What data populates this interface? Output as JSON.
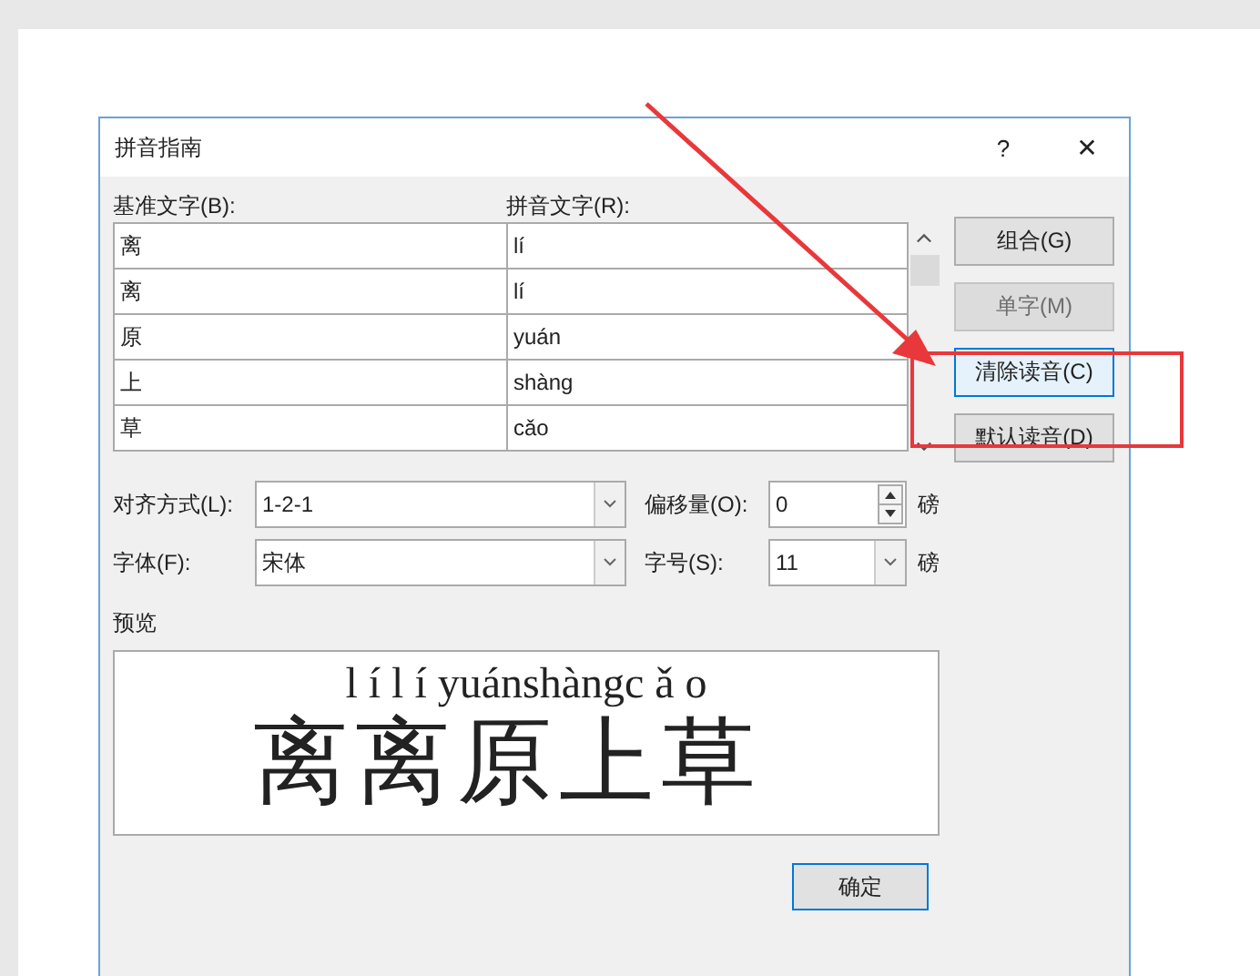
{
  "dialog": {
    "title": "拼音指南",
    "help_button": "?",
    "close_button": "✕"
  },
  "columns": {
    "base_label": "基准文字(B):",
    "ruby_label": "拼音文字(R):"
  },
  "rows": [
    {
      "base": "离",
      "ruby": "lí"
    },
    {
      "base": "离",
      "ruby": "lí"
    },
    {
      "base": "原",
      "ruby": "yuán"
    },
    {
      "base": "上",
      "ruby": "shàng"
    },
    {
      "base": "草",
      "ruby": "cǎo"
    }
  ],
  "buttons": [
    {
      "label": "组合(G)",
      "disabled": false,
      "focused": false
    },
    {
      "label": "单字(M)",
      "disabled": true,
      "focused": false
    },
    {
      "label": "清除读音(C)",
      "disabled": false,
      "focused": true
    },
    {
      "label": "默认读音(D)",
      "disabled": false,
      "focused": false
    }
  ],
  "alignment": {
    "label": "对齐方式(L):",
    "value": "1-2-1"
  },
  "offset": {
    "label": "偏移量(O):",
    "value": "0",
    "unit": "磅"
  },
  "font": {
    "label": "字体(F):",
    "value": "宋体"
  },
  "size": {
    "label": "字号(S):",
    "value": "11",
    "unit": "磅"
  },
  "preview": {
    "label": "预览",
    "ruby": "l í l í yuánshàngc ǎ o",
    "base": "离离原上草"
  },
  "ok_button": "确定"
}
